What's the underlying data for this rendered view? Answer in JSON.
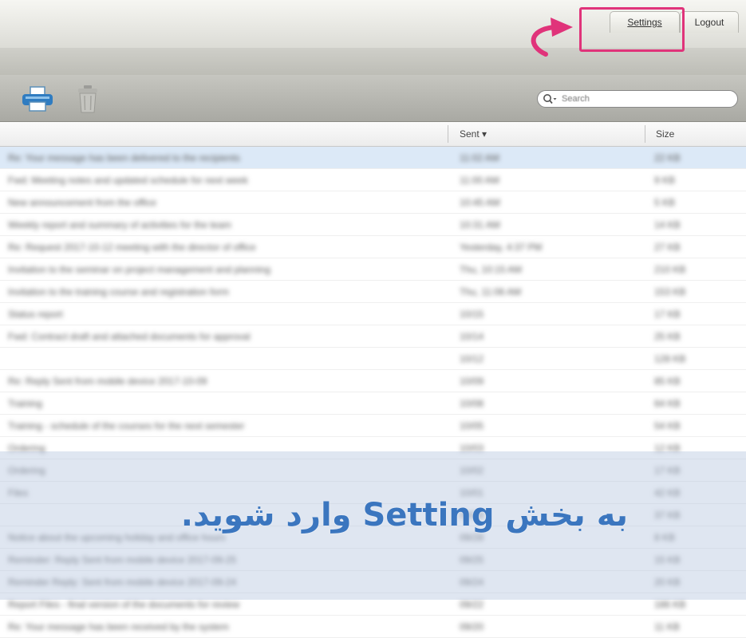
{
  "nav": {
    "settings_tab": "Settings",
    "logout_tab": "Logout"
  },
  "toolbar": {
    "print_icon": "printer-icon",
    "delete_icon": "trash-icon",
    "search": {
      "placeholder": "Search"
    }
  },
  "table": {
    "columns": {
      "subject": "",
      "sent": "Sent ▾",
      "size": "Size"
    },
    "rows": [
      {
        "subject": "Re: Your message has been delivered to the recipients",
        "sent": "11:02 AM",
        "size": "22 KB"
      },
      {
        "subject": "Fwd: Meeting notes and updated schedule for next week",
        "sent": "11:00 AM",
        "size": "9 KB"
      },
      {
        "subject": "New announcement from the office",
        "sent": "10:45 AM",
        "size": "5 KB"
      },
      {
        "subject": "Weekly report and summary of activities for the team",
        "sent": "10:31 AM",
        "size": "14 KB"
      },
      {
        "subject": "Re: Request 2017-10-12 meeting with the director of office",
        "sent": "Yesterday, 4:37 PM",
        "size": "27 KB"
      },
      {
        "subject": "Invitation to the seminar on project management and planning",
        "sent": "Thu, 10:15 AM",
        "size": "210 KB"
      },
      {
        "subject": "Invitation to the training course and registration form",
        "sent": "Thu, 11:06 AM",
        "size": "153 KB"
      },
      {
        "subject": "Status report",
        "sent": "10/15",
        "size": "17 KB"
      },
      {
        "subject": "Fwd: Contract draft and attached documents for approval",
        "sent": "10/14",
        "size": "25 KB"
      },
      {
        "subject": "",
        "sent": "10/12",
        "size": "128 KB"
      },
      {
        "subject": "Re: Reply Sent from mobile device 2017-10-09",
        "sent": "10/09",
        "size": "85 KB"
      },
      {
        "subject": "Training",
        "sent": "10/08",
        "size": "64 KB"
      },
      {
        "subject": "Training - schedule of the courses for the next semester",
        "sent": "10/05",
        "size": "54 KB"
      },
      {
        "subject": "Ordering",
        "sent": "10/03",
        "size": "12 KB"
      },
      {
        "subject": "Ordering",
        "sent": "10/02",
        "size": "17 KB"
      },
      {
        "subject": "Files",
        "sent": "10/01",
        "size": "42 KB"
      },
      {
        "subject": "",
        "sent": "09/29",
        "size": "37 KB"
      },
      {
        "subject": "Notice about the upcoming holiday and office hours",
        "sent": "09/28",
        "size": "8 KB"
      },
      {
        "subject": "Reminder: Reply Sent from mobile device 2017-09-25",
        "sent": "09/25",
        "size": "15 KB"
      },
      {
        "subject": "Reminder Reply: Sent from mobile device 2017-09-24",
        "sent": "09/24",
        "size": "20 KB"
      },
      {
        "subject": "Report Files - final version of the documents for review",
        "sent": "09/22",
        "size": "186 KB"
      },
      {
        "subject": "Re: Your message has been received by the system",
        "sent": "09/20",
        "size": "11 KB"
      }
    ]
  },
  "caption": "به بخش Setting وارد شوید.",
  "colors": {
    "highlight": "#e0337a",
    "caption": "#3b76bf",
    "selected_row": "#dce9f7"
  }
}
